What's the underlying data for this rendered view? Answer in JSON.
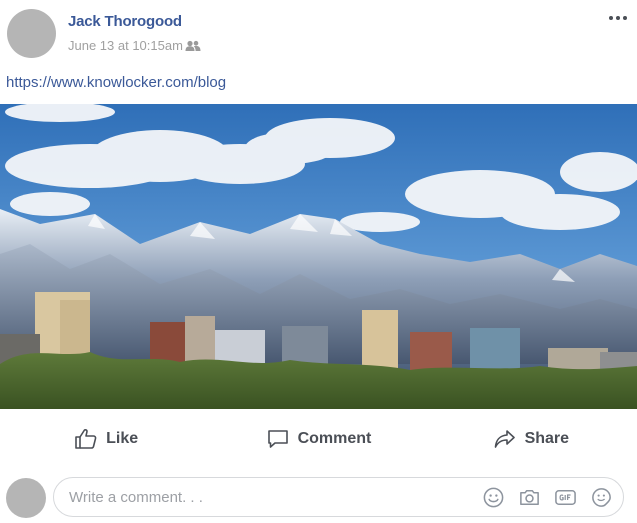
{
  "post": {
    "author": "Jack Thorogood",
    "timestamp": "June 13 at 10:15am",
    "audience_icon": "friends-icon",
    "link": "https://www.knowlocker.com/blog"
  },
  "actions": {
    "like_label": "Like",
    "comment_label": "Comment",
    "share_label": "Share"
  },
  "comment": {
    "placeholder": "Write a comment. . .",
    "icons": [
      "emoji-icon",
      "camera-icon",
      "gif-icon",
      "sticker-icon"
    ]
  },
  "colors": {
    "author": "#3b5998",
    "link": "#3b5998",
    "muted": "#a0a0a0",
    "action": "#4b4f56"
  }
}
